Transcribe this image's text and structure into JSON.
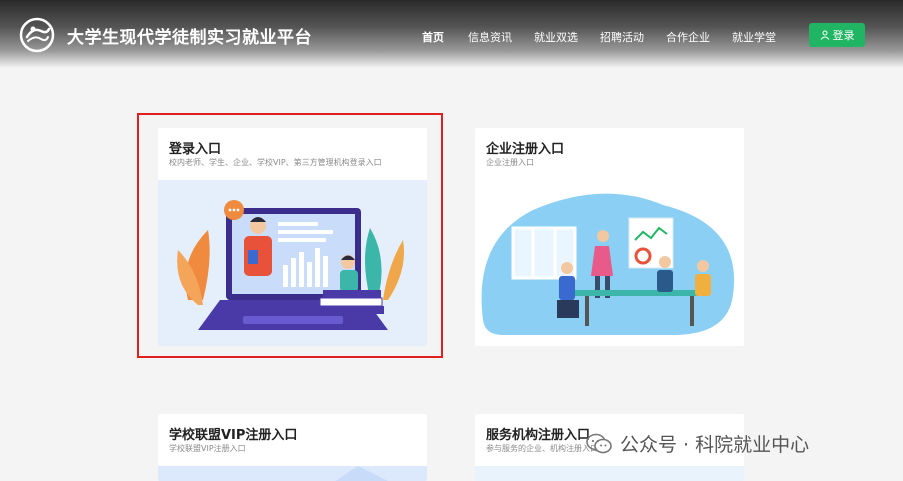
{
  "header": {
    "site_title": "大学生现代学徒制实习就业平台",
    "nav": [
      {
        "label": "首页",
        "active": true
      },
      {
        "label": "信息资讯"
      },
      {
        "label": "就业双选"
      },
      {
        "label": "招聘活动"
      },
      {
        "label": "合作企业"
      },
      {
        "label": "就业学堂"
      }
    ],
    "login_label": "登录"
  },
  "cards": [
    {
      "title": "登录入口",
      "subtitle": "校内老师、学生、企业、学校VIP、第三方管理机构登录入口"
    },
    {
      "title": "企业注册入口",
      "subtitle": "企业注册入口"
    },
    {
      "title": "学校联盟VIP注册入口",
      "subtitle": "学校联盟VIP注册入口"
    },
    {
      "title": "服务机构注册入口",
      "subtitle": "参与服务的企业、机构注册入口"
    }
  ],
  "watermark": {
    "text": "公众号 · 科院就业中心"
  },
  "colors": {
    "accent": "#20b562",
    "highlight": "#e02020"
  }
}
